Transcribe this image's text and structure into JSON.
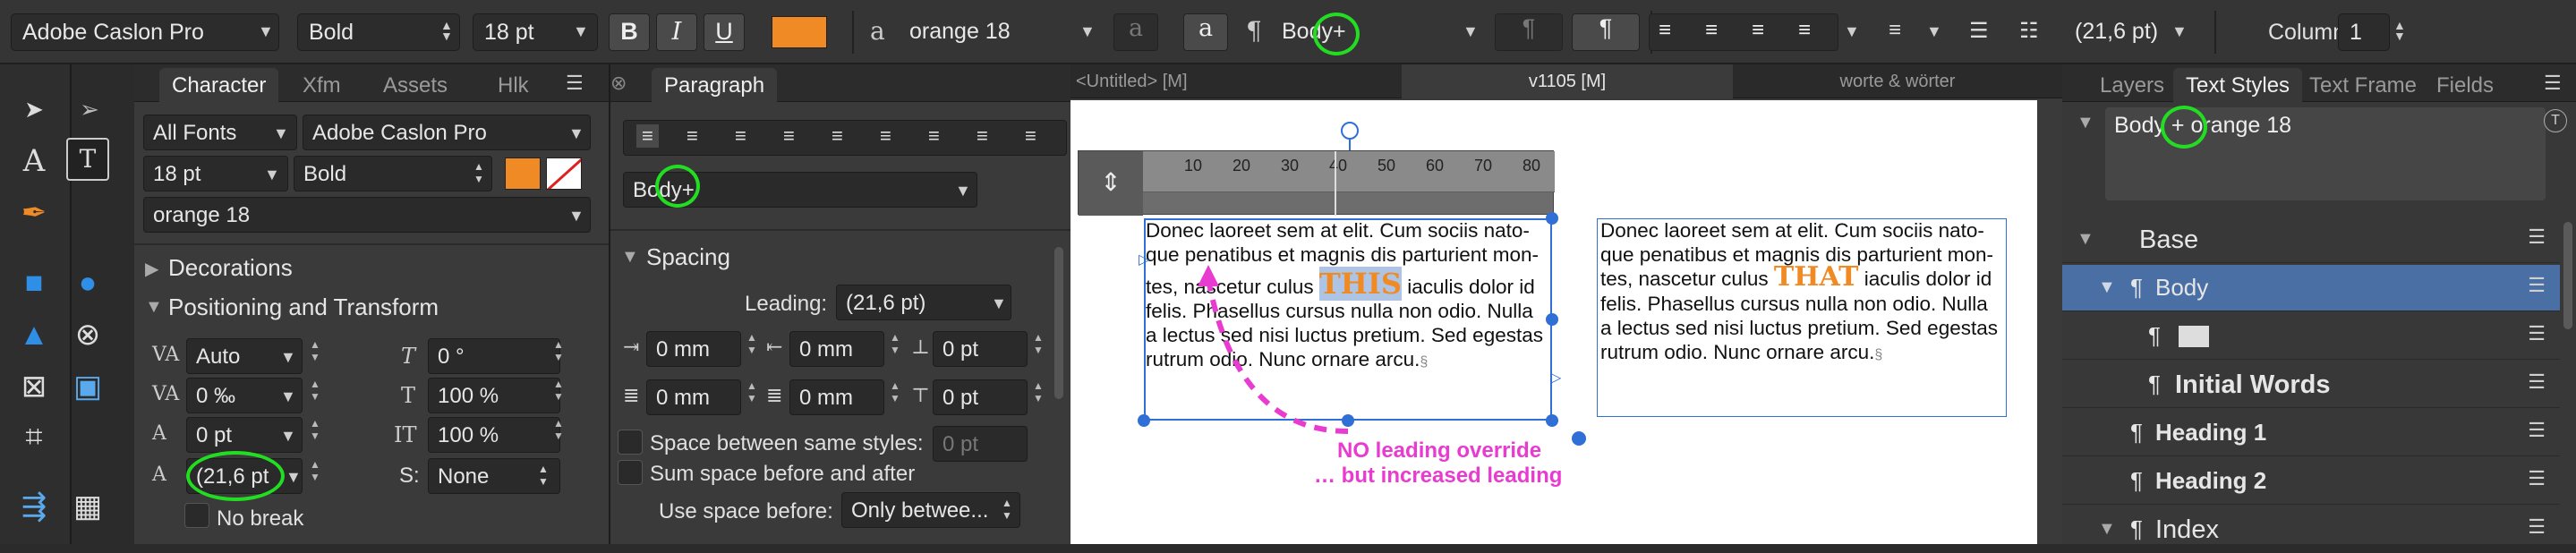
{
  "toolbar": {
    "font_family": "Adobe Caslon Pro",
    "font_weight": "Bold",
    "font_size": "18 pt",
    "bold_label": "B",
    "italic_label": "I",
    "underline_label": "U",
    "char_style_icon": "a",
    "char_style": "orange 18",
    "clear_char_icon": "a",
    "para_icon": "a",
    "pilcrow": "¶",
    "para_style": "Body+",
    "leading": "(21,6 pt)",
    "columns_label": "Columns:",
    "columns_value": "1"
  },
  "character_panel": {
    "tabs": [
      "Character",
      "Xfm",
      "Assets",
      "Hlk"
    ],
    "font_collection": "All Fonts",
    "font_family": "Adobe Caslon Pro",
    "font_size": "18 pt",
    "font_weight": "Bold",
    "char_style": "orange 18",
    "sections": {
      "decorations": "Decorations",
      "positioning": "Positioning and Transform"
    },
    "kerning": "Auto",
    "tracking": "0 ‰",
    "baseline": "0 pt",
    "leading": "(21,6 pt",
    "shear": "0 °",
    "vert_scale": "100 %",
    "horiz_scale": "100 %",
    "script": "None",
    "script_label": "S:",
    "no_break": "No break"
  },
  "paragraph_panel": {
    "tab": "Paragraph",
    "para_style": "Body+",
    "spacing_section": "Spacing",
    "leading_label": "Leading:",
    "leading_value": "(21,6 pt)",
    "left_indent": "0 mm",
    "first_indent": "0 mm",
    "space_before": "0 pt",
    "right_indent": "0 mm",
    "last_indent": "0 mm",
    "space_after": "0 pt",
    "same_styles_label": "Space between same styles:",
    "same_styles_value": "0 pt",
    "sum_space_label": "Sum space before and after",
    "use_space_label": "Use space before:",
    "use_space_value": "Only betwee..."
  },
  "document": {
    "tabs": [
      "<Untitled> [M]",
      "v1105 [M]",
      "worte & wörter"
    ],
    "ruler_ticks": [
      "10",
      "20",
      "30",
      "40",
      "50",
      "60",
      "70",
      "80"
    ],
    "para1": {
      "line1": "Donec laoreet sem at elit. Cum sociis nato-",
      "line2": "que penatibus et magnis dis parturient mon-",
      "line3_pre": "tes, nascetur culus ",
      "line3_word": "THIS",
      "line3_post": " iaculis dolor id",
      "line4": "felis. Phasellus cursus nulla non odio. Nulla",
      "line5": "a lectus sed nisi luctus pretium. Sed egestas",
      "line6": "rutrum odio. Nunc ornare arcu.",
      "end_mark": "§"
    },
    "para2": {
      "line1": "Donec laoreet sem at elit. Cum sociis nato-",
      "line2": "que penatibus et magnis dis parturient mon-",
      "line3_pre": "tes, nascetur culus ",
      "line3_word": "THAT",
      "line3_post": " iaculis dolor id",
      "line4": "felis. Phasellus cursus nulla non odio. Nulla",
      "line5": "a lectus sed nisi luctus pretium. Sed egestas",
      "line6": "rutrum odio. Nunc ornare arcu.",
      "end_mark": "§"
    },
    "annotation1": "NO leading override",
    "annotation2": "… but increased leading"
  },
  "right_panel": {
    "tabs": [
      "Layers",
      "Text Styles",
      "Text Frame",
      "Fields"
    ],
    "applied_style": "Body + orange 18",
    "styles": [
      {
        "name": "Base"
      },
      {
        "name": "Body"
      },
      {
        "name": ""
      },
      {
        "name": "Initial Words"
      },
      {
        "name": "Heading 1"
      },
      {
        "name": "Heading 2"
      },
      {
        "name": "Index"
      }
    ]
  },
  "colors": {
    "accent_orange": "#f08a24",
    "annotation_magenta": "#e83bd0",
    "highlight_green": "#22dd22",
    "selection_blue": "#2f6fd6"
  }
}
